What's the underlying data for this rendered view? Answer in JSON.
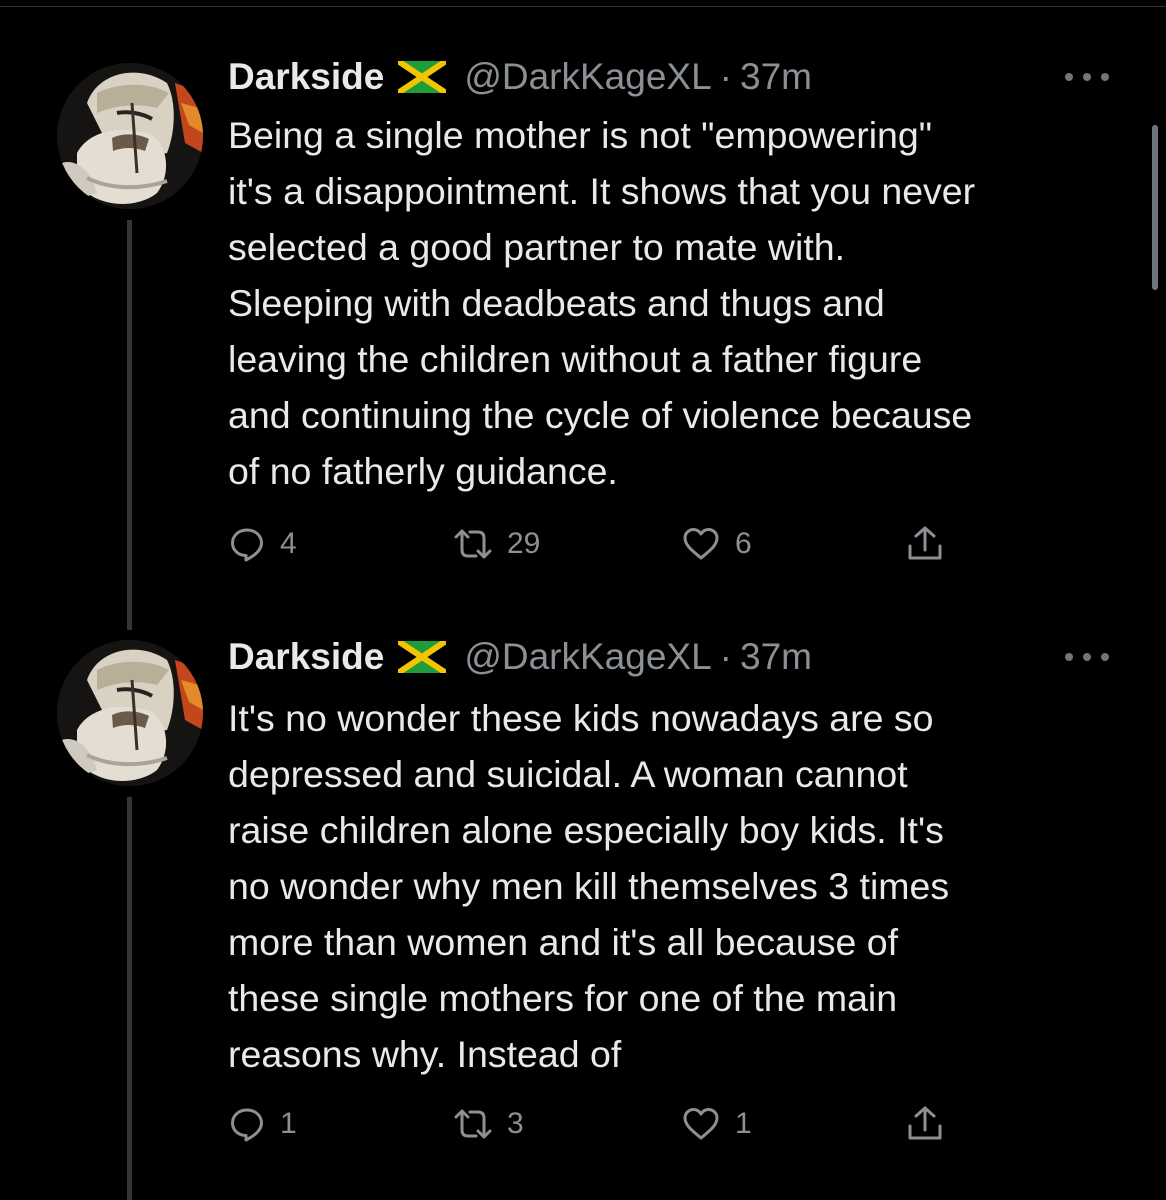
{
  "colors": {
    "background": "#000000",
    "text_primary": "#e7e9ea",
    "text_secondary": "#8b9095",
    "thread_line": "#333639"
  },
  "icons": {
    "verified_flag": "jamaica-flag-icon",
    "reply": "speech-bubble-icon",
    "retweet": "retweet-arrows-icon",
    "like": "heart-icon",
    "share": "share-upload-icon",
    "more": "three-dots-icon"
  },
  "tweets": [
    {
      "author": {
        "name": "Darkside",
        "handle": "@DarkKageXL"
      },
      "separator": "·",
      "time": "37m",
      "text": "Being a single mother is not \"empowering\"\nit's a disappointment. It shows that you never\nselected a good partner to mate with.\nSleeping with deadbeats and thugs and\nleaving the children without a father figure\nand continuing the cycle of violence because\nof no fatherly guidance.",
      "stats": {
        "replies": "4",
        "retweets": "29",
        "likes": "6"
      }
    },
    {
      "author": {
        "name": "Darkside",
        "handle": "@DarkKageXL"
      },
      "separator": "·",
      "time": "37m",
      "text": "It's no wonder these kids nowadays are so\ndepressed and suicidal. A woman cannot\nraise children alone especially boy kids. It's\nno wonder why men kill themselves 3 times\nmore than women and it's all because of\nthese single mothers for one of the main\nreasons why. Instead of",
      "stats": {
        "replies": "1",
        "retweets": "3",
        "likes": "1"
      }
    }
  ]
}
